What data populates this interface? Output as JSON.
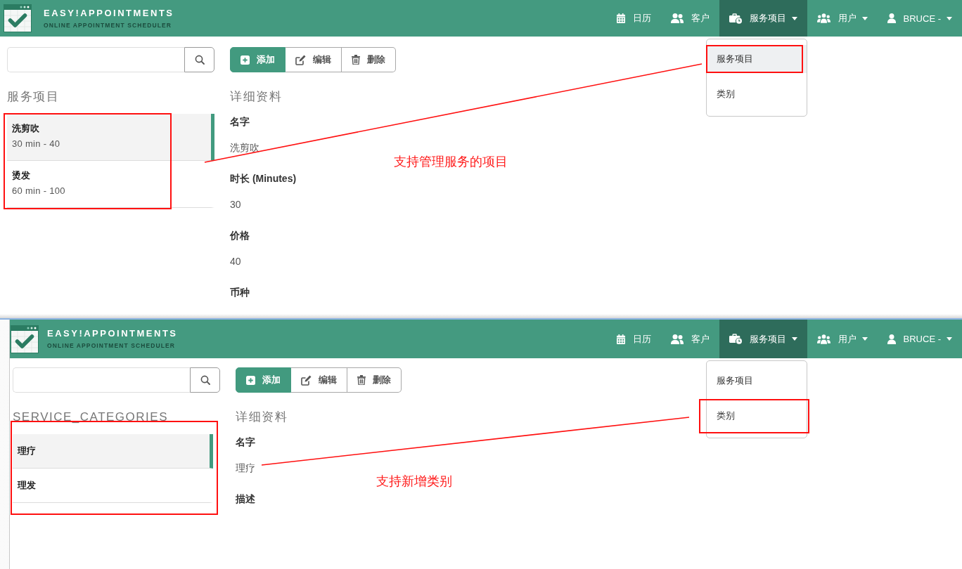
{
  "screens": [
    {
      "brand": {
        "title": "EASY!APPOINTMENTS",
        "subtitle": "ONLINE APPOINTMENT SCHEDULER"
      },
      "nav": [
        {
          "label": "日历",
          "selected": false,
          "dropdown": false
        },
        {
          "label": "客户",
          "selected": false,
          "dropdown": false
        },
        {
          "label": "服务项目",
          "selected": true,
          "dropdown": true,
          "menu": [
            {
              "label": "服务项目",
              "selected": true,
              "framed": true
            },
            {
              "label": "类别",
              "selected": false,
              "framed": false
            }
          ]
        },
        {
          "label": "用户",
          "selected": false,
          "dropdown": true
        },
        {
          "label": "BRUCE -",
          "selected": false,
          "dropdown": true
        }
      ],
      "toolbar": [
        {
          "label": "添加",
          "kind": "primary"
        },
        {
          "label": "编辑",
          "kind": "default"
        },
        {
          "label": "删除",
          "kind": "default"
        }
      ],
      "list": {
        "title": "服务项目",
        "framed": true,
        "items": [
          {
            "name": "洗剪吹",
            "detail": "30 min - 40",
            "selected": true
          },
          {
            "name": "烫发",
            "detail": "60 min - 100",
            "selected": false
          }
        ]
      },
      "details": {
        "title": "详细资料",
        "fields": [
          {
            "label": "名字",
            "value": "洗剪吹"
          },
          {
            "label": "时长 (Minutes)",
            "value": "30"
          },
          {
            "label": "价格",
            "value": "40"
          },
          {
            "label": "币种"
          }
        ]
      },
      "annotation": "支持管理服务的项目"
    },
    {
      "brand": {
        "title": "EASY!APPOINTMENTS",
        "subtitle": "ONLINE APPOINTMENT SCHEDULER"
      },
      "nav": [
        {
          "label": "日历",
          "selected": false,
          "dropdown": false
        },
        {
          "label": "客户",
          "selected": false,
          "dropdown": false
        },
        {
          "label": "服务项目",
          "selected": true,
          "dropdown": true,
          "menu": [
            {
              "label": "服务项目",
              "selected": false,
              "framed": false
            },
            {
              "label": "类别",
              "selected": false,
              "framed": true
            }
          ]
        },
        {
          "label": "用户",
          "selected": false,
          "dropdown": true
        },
        {
          "label": "BRUCE -",
          "selected": false,
          "dropdown": true
        }
      ],
      "toolbar": [
        {
          "label": "添加",
          "kind": "primary"
        },
        {
          "label": "编辑",
          "kind": "default"
        },
        {
          "label": "删除",
          "kind": "default"
        }
      ],
      "list": {
        "title": "SERVICE_CATEGORIES",
        "framed": true,
        "items": [
          {
            "name": "理疗",
            "selected": true
          },
          {
            "name": "理发",
            "selected": false
          }
        ]
      },
      "details": {
        "title": "详细资料",
        "fields": [
          {
            "label": "名字",
            "value": "理疗"
          },
          {
            "label": "描述"
          }
        ]
      },
      "annotation": "支持新增类别"
    }
  ]
}
